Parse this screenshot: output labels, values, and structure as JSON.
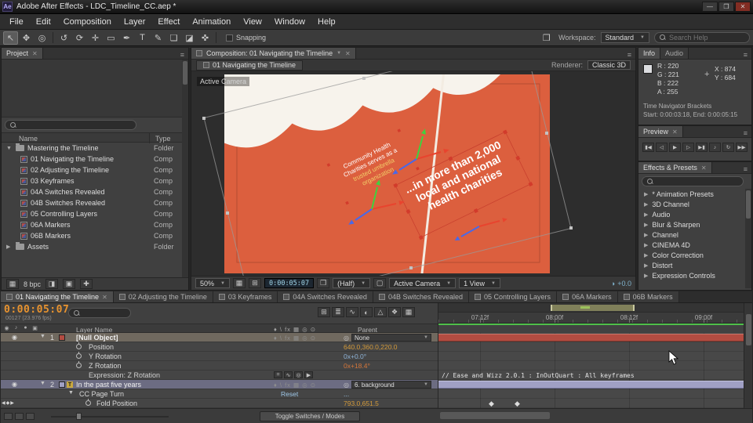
{
  "titlebar": {
    "title": "Adobe After Effects - LDC_Timeline_CC.aep *"
  },
  "menus": [
    "File",
    "Edit",
    "Composition",
    "Layer",
    "Effect",
    "Animation",
    "View",
    "Window",
    "Help"
  ],
  "toolbar": {
    "snapping": "Snapping",
    "workspace_label": "Workspace:",
    "workspace_value": "Standard",
    "search_placeholder": "Search Help"
  },
  "project": {
    "tab": "Project",
    "name_col": "Name",
    "type_col": "Type",
    "footer_depth": "8 bpc",
    "items": [
      {
        "name": "Mastering the Timeline",
        "type": "Folder"
      },
      {
        "name": "01 Navigating the Timeline",
        "type": "Comp"
      },
      {
        "name": "02 Adjusting the Timeline",
        "type": "Comp"
      },
      {
        "name": "03 Keyframes",
        "type": "Comp"
      },
      {
        "name": "04A Switches Revealed",
        "type": "Comp"
      },
      {
        "name": "04B Switches Revealed",
        "type": "Comp"
      },
      {
        "name": "05 Controlling Layers",
        "type": "Comp"
      },
      {
        "name": "06A Markers",
        "type": "Comp"
      },
      {
        "name": "06B Markers",
        "type": "Comp"
      },
      {
        "name": "Assets",
        "type": "Folder"
      }
    ]
  },
  "comp": {
    "tab": "Composition: 01 Navigating the Timeline",
    "crumb": "01 Navigating the Timeline",
    "renderer_label": "Renderer:",
    "renderer_value": "Classic 3D",
    "camera_label": "Active Camera",
    "canvas": {
      "bg": "#dc5f3e",
      "small_text": [
        "Community Health",
        "Charities serves as a",
        "trusted umbrella",
        "organization"
      ],
      "big_text": [
        "...in more than 2,000",
        "local and national",
        "health charities"
      ]
    },
    "footer": {
      "zoom": "50%",
      "timecode": "0:00:05:07",
      "resolution": "(Half)",
      "camera": "Active Camera",
      "view": "1 View",
      "exposure": "+0.0"
    }
  },
  "info": {
    "tab": "Info",
    "tab2": "Audio",
    "r": "R : 220",
    "g": "G : 221",
    "b": "B : 222",
    "a": "A : 255",
    "x": "X : 874",
    "y": "Y : 684",
    "swatch": "#dcdde0",
    "note1": "Time Navigator Brackets",
    "note2": "Start: 0:00:03:18, End: 0:00:05:15"
  },
  "preview": {
    "tab": "Preview"
  },
  "effects": {
    "tab": "Effects & Presets",
    "items": [
      "* Animation Presets",
      "3D Channel",
      "Audio",
      "Blur & Sharpen",
      "Channel",
      "CINEMA 4D",
      "Color Correction",
      "Distort",
      "Expression Controls"
    ]
  },
  "tl_tabs": [
    "01 Navigating the Timeline",
    "02 Adjusting the Timeline",
    "03 Keyframes",
    "04A Switches Revealed",
    "04B Switches Revealed",
    "05 Controlling Layers",
    "06A Markers",
    "06B Markers"
  ],
  "timeline": {
    "timecode": "0:00:05:07",
    "frames": "00127 (23.976 fps)",
    "layer_name_col": "Layer Name",
    "parent_col": "Parent",
    "ruler": [
      "07:12f",
      "08:00f",
      "08:12f",
      "09:00f"
    ],
    "expression_comment": "// Ease and Wizz 2.0.1 : InOutQuart : All keyframes",
    "toggle_modes": "Toggle Switches / Modes",
    "rows": [
      {
        "idx": "1",
        "name": "[Null Object]",
        "parent": "None"
      },
      {
        "name": "Position",
        "value": "640.0,360.0,220.0"
      },
      {
        "name": "Y Rotation",
        "value": "0x+0.0°"
      },
      {
        "name": "Z Rotation",
        "value": "0x+18.4°"
      },
      {
        "name": "Expression: Z Rotation"
      },
      {
        "idx": "2",
        "name": "In the past five years",
        "parent": "6. background"
      },
      {
        "name": "CC Page Turn",
        "reset": "Reset",
        "more": "..."
      },
      {
        "name": "Fold Position",
        "value": "793.0,651.5"
      }
    ]
  },
  "colors": {
    "comp_bg": "#dc5f3e",
    "timecode_orange": "#e8932f",
    "value_blue": "#8fb3d6",
    "value_gold": "#d39a3a",
    "value_expression": "#d4763a",
    "layer1_label": "#b34c41",
    "layer2_label": "#a0a0c4",
    "cache_green": "#4fbf4a"
  },
  "icons": {
    "app_badge": "Ae",
    "close": "✕",
    "minimize": "—",
    "maximize": "❒",
    "menu": "≡",
    "dd": "▼",
    "tw_open": "▼",
    "tw_closed": "▶",
    "workspace": "❒",
    "tools": [
      "↖",
      "✥",
      "◎",
      "↺",
      "⟳",
      "✛",
      "▭",
      "✒",
      "T",
      "✎",
      "❏",
      "◪",
      "✜"
    ],
    "tl_icons": [
      "⊞",
      "≣",
      "∿",
      "◐",
      "△",
      "❖",
      "▦"
    ],
    "transport": [
      "▮◀",
      "◁",
      "▶",
      "▷",
      "▶▮",
      "♪",
      "↻",
      "▶▶"
    ],
    "expr": [
      "=",
      "∿",
      "◎",
      "▶"
    ],
    "switches": "♦ \\ fx ▦ ◎ ⊙",
    "eye": "◉",
    "audio": "♪",
    "solo": "●",
    "lock": "▣",
    "pickwhip": "◎",
    "crosshair": "+",
    "kf": "◆",
    "kf_prev": "◀",
    "kf_next": "▶",
    "text_layer": "T",
    "comp_icons": {
      "grid": "▦",
      "mask": "⊞",
      "cam": "❒",
      "region": "▢",
      "exposure": "◑"
    },
    "proj_icons": [
      "▦",
      "◨",
      "▣",
      "✚"
    ]
  }
}
